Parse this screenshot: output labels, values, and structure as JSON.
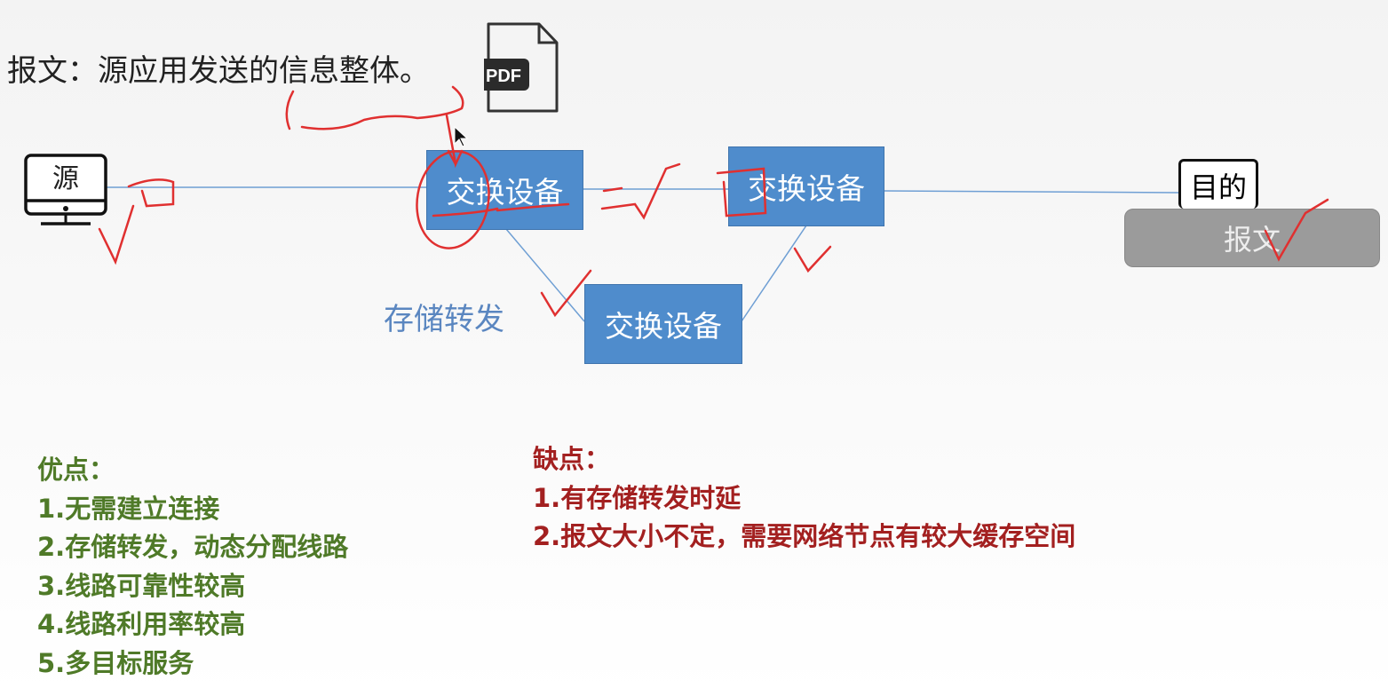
{
  "definition": "报文：源应用发送的信息整体。",
  "pdf_icon": {
    "label": "PDF"
  },
  "source_label": "源",
  "switch_label": "交换设备",
  "store_forward": "存储转发",
  "dest_label": "目的",
  "message_label": "报文",
  "pros": {
    "title": "优点：",
    "items": [
      "1.无需建立连接",
      "2.存储转发，动态分配线路",
      "3.线路可靠性较高",
      "4.线路利用率较高",
      "5.多目标服务"
    ]
  },
  "cons": {
    "title": "缺点：",
    "items": [
      "1.有存储转发时延",
      "2.报文大小不定，需要网络节点有较大缓存空间"
    ]
  },
  "colors": {
    "switch": "#4f8ccc",
    "pros": "#4f7a28",
    "cons": "#a32020",
    "ink": "#e03030"
  }
}
